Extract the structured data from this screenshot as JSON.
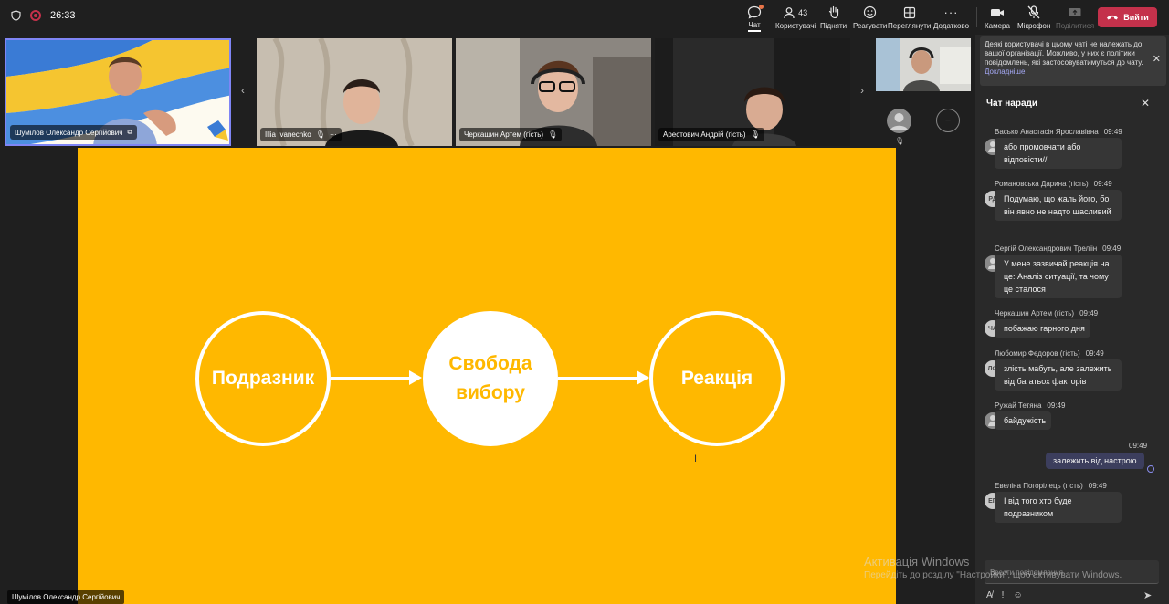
{
  "colors": {
    "accent": "#7f85f5",
    "leave": "#c4314b",
    "slide_bg": "#ffb800",
    "chat_bg": "#292929"
  },
  "topbar": {
    "timer": "26:33",
    "participants_count": "43",
    "buttons": {
      "chat": "Чат",
      "people": "Користувачі",
      "raise": "Підняти",
      "react": "Реагувати",
      "view": "Переглянути",
      "more": "Додатково",
      "camera": "Камера",
      "mic": "Мікрофон",
      "share": "Поділитися",
      "leave": "Вийти"
    }
  },
  "videos": [
    {
      "name": "Шумілов Олександр Сергійович"
    },
    {
      "name": "Illia Ivanechko"
    },
    {
      "name": "Черкашин Артем (гість)"
    },
    {
      "name": "Арестович Андрій (гість)"
    }
  ],
  "slide": {
    "stimulus": "Подразник",
    "freedom_line1": "Свобода",
    "freedom_line2": "вибору",
    "reaction": "Реакція"
  },
  "presenter_label": "Шумілов Олександр Сергійович",
  "chat": {
    "notice": "Деякі користувачі в цьому чаті не належать до вашої організації. Можливо, у них є політики повідомлень, які застосовуватимуться до чату.",
    "notice_link": "Докладніше",
    "title": "Чат наради",
    "messages": [
      {
        "author": "Васько Анастасія Ярославівна",
        "time": "09:49",
        "initials": "",
        "text": "або промовчати або відповісти//"
      },
      {
        "author": "Романовська Дарина (гість)",
        "time": "09:49",
        "initials": "РД",
        "text": "Подумаю, що жаль його, бо він явно не надто щасливий"
      },
      {
        "author": "Сергій Олександрович Треліін",
        "time": "09:49",
        "initials": "",
        "text": "У мене зазвичай реакція на це: Аналіз ситуації, та чому це сталося"
      },
      {
        "author": "Черкашин Артем (гість)",
        "time": "09:49",
        "initials": "ЧА",
        "text": "побажаю гарного дня"
      },
      {
        "author": "Любомир Федоров (гість)",
        "time": "09:49",
        "initials": "ЛФ",
        "text": "злість мабуть, але залежить від багатьох факторів"
      },
      {
        "author": "Ружай Тетяна",
        "time": "09:49",
        "initials": "",
        "text": "байдужість"
      },
      {
        "author": "Евеліна Погорілець (гість)",
        "time": "09:49",
        "initials": "ЕП",
        "text": "І від того хто буде подразником"
      }
    ],
    "my_message": {
      "time": "09:49",
      "text": "залежить від настрою"
    },
    "compose_placeholder": "Ввести повідомлення"
  },
  "watermark": {
    "line1": "Активація Windows",
    "line2": "Перейдіть до розділу \"Настройки\", щоб активувати Windows."
  }
}
